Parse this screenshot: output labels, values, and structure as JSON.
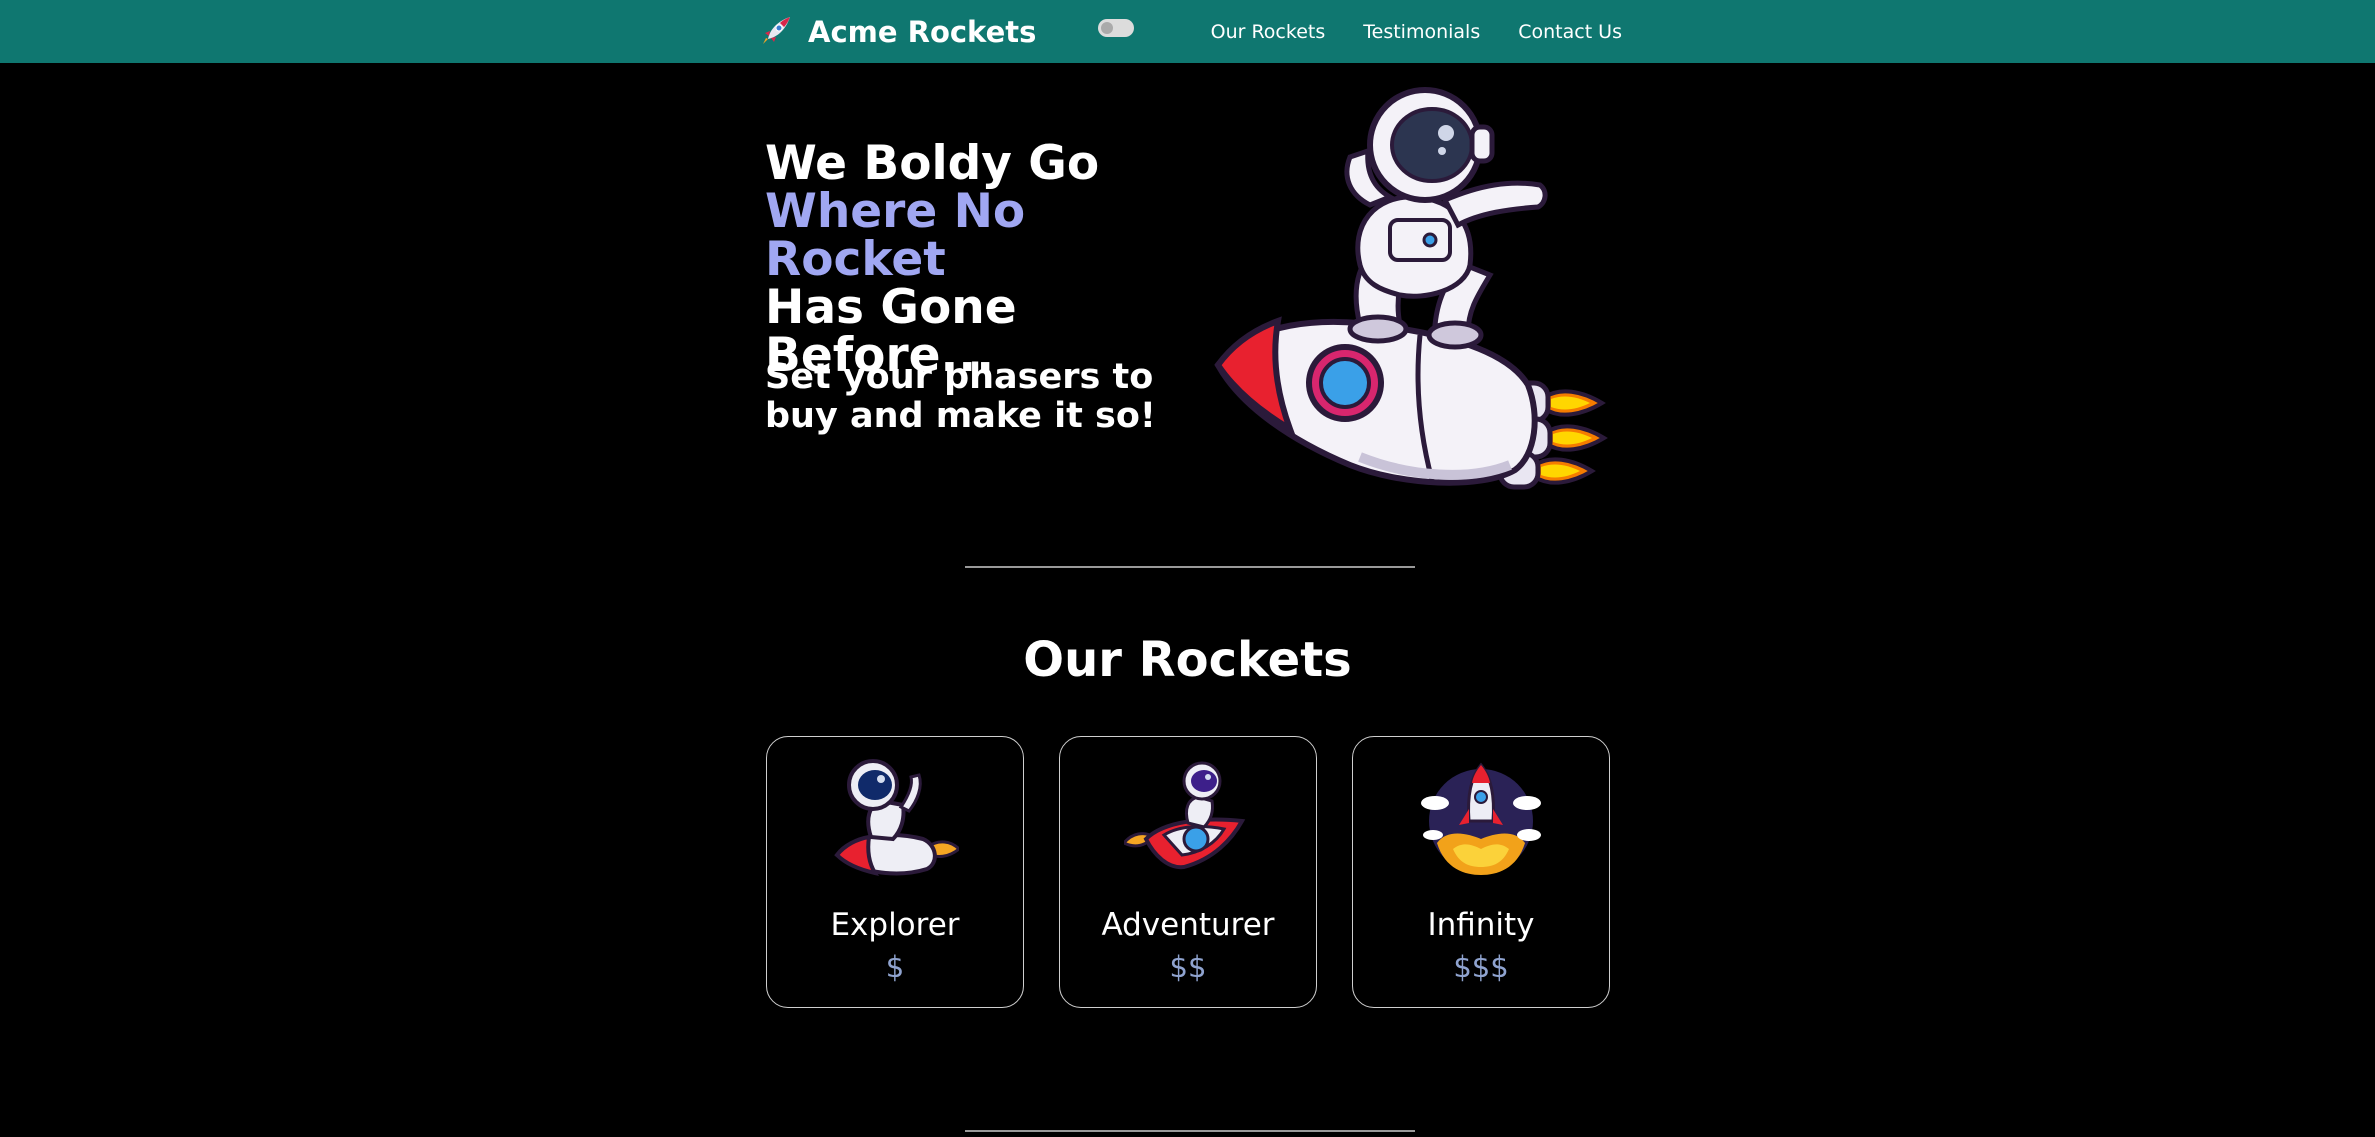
{
  "navbar": {
    "brand": "Acme Rockets",
    "links": [
      "Our Rockets",
      "Testimonials",
      "Contact Us"
    ],
    "bg_color": "#0f7770"
  },
  "hero": {
    "line1": "We Boldy Go",
    "line2": "Where No Rocket",
    "line3": "Has Gone",
    "line4": "Before...",
    "subtitle": "Set your phasers to buy and make it so!",
    "accent_color": "#a0a7f2"
  },
  "rockets": {
    "title": "Our Rockets",
    "cards": [
      {
        "name": "Explorer",
        "price": "$"
      },
      {
        "name": "Adventurer",
        "price": "$$"
      },
      {
        "name": "Infinity",
        "price": "$$$"
      }
    ]
  },
  "icons": {
    "brand": "rocket-icon",
    "toggle": "theme-toggle",
    "hero": "astronaut-on-rocket-illustration"
  }
}
